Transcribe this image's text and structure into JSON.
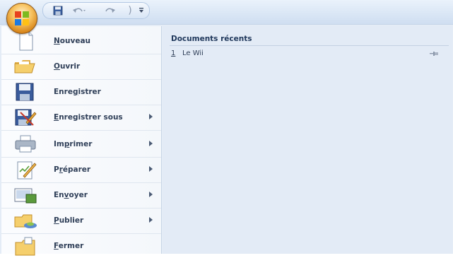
{
  "quick_access": {
    "icons": [
      "office-button-icon",
      "save-icon",
      "undo-icon",
      "redo-icon",
      "customize-dropdown-icon"
    ]
  },
  "menu": {
    "items": [
      {
        "label_acc": "N",
        "label_rest": "ouveau",
        "icon": "new-document-icon",
        "submenu": false
      },
      {
        "label_acc": "O",
        "label_rest": "uvrir",
        "icon": "open-folder-icon",
        "submenu": false
      },
      {
        "label_pre": "Enre",
        "label_acc": "g",
        "label_rest": "istrer",
        "icon": "save-icon",
        "submenu": false
      },
      {
        "label_acc": "E",
        "label_rest": "nregistrer sous",
        "icon": "save-as-icon",
        "submenu": true
      },
      {
        "label_pre": "Im",
        "label_acc": "p",
        "label_rest": "rimer",
        "icon": "print-icon",
        "submenu": true
      },
      {
        "label_pre": "P",
        "label_acc": "r",
        "label_rest": "éparer",
        "icon": "prepare-icon",
        "submenu": true
      },
      {
        "label_pre": "En",
        "label_acc": "v",
        "label_rest": "oyer",
        "icon": "send-icon",
        "submenu": true
      },
      {
        "label_acc": "P",
        "label_rest": "ublier",
        "icon": "publish-icon",
        "submenu": true
      },
      {
        "label_acc": "F",
        "label_rest": "ermer",
        "icon": "close-folder-icon",
        "submenu": false
      }
    ]
  },
  "recent": {
    "title": "Documents récents",
    "items": [
      {
        "number": "1",
        "name": "Le Wii"
      }
    ]
  },
  "colors": {
    "accent": "#2f3f58",
    "pane_bg": "#e3ebf6",
    "titlebar": "#dce8f6"
  }
}
